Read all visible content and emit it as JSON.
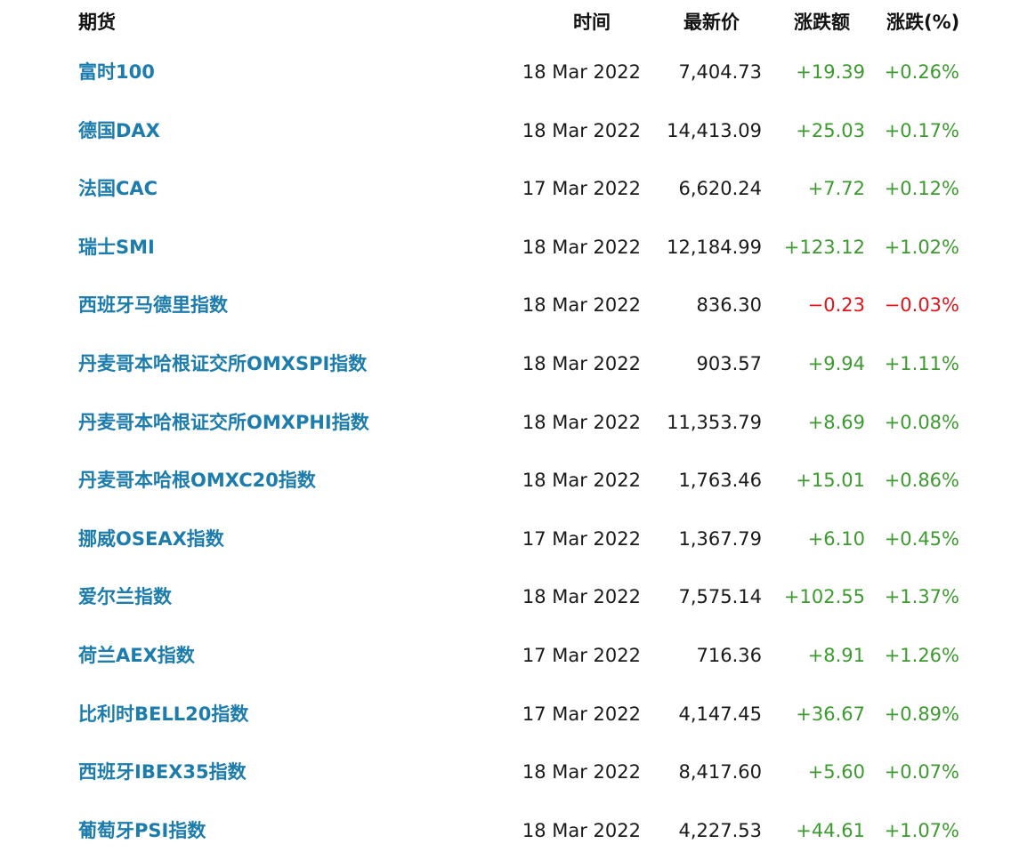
{
  "header": {
    "name": "期货",
    "time": "时间",
    "price": "最新价",
    "change": "涨跌额",
    "pct": "涨跌(%)"
  },
  "colors": {
    "link": "#1c7cad",
    "up": "#3c9a2f",
    "down": "#e3141b",
    "text": "#1a1a1a"
  },
  "rows": [
    {
      "name": "富时100",
      "date": "18 Mar 2022",
      "price": "7,404.73",
      "change": "+19.39",
      "pct": "+0.26%",
      "dir": "up"
    },
    {
      "name": "德国DAX",
      "date": "18 Mar 2022",
      "price": "14,413.09",
      "change": "+25.03",
      "pct": "+0.17%",
      "dir": "up"
    },
    {
      "name": "法国CAC",
      "date": "17 Mar 2022",
      "price": "6,620.24",
      "change": "+7.72",
      "pct": "+0.12%",
      "dir": "up"
    },
    {
      "name": "瑞士SMI",
      "date": "18 Mar 2022",
      "price": "12,184.99",
      "change": "+123.12",
      "pct": "+1.02%",
      "dir": "up"
    },
    {
      "name": "西班牙马德里指数",
      "date": "18 Mar 2022",
      "price": "836.30",
      "change": "−0.23",
      "pct": "−0.03%",
      "dir": "down"
    },
    {
      "name": "丹麦哥本哈根证交所OMXSPI指数",
      "date": "18 Mar 2022",
      "price": "903.57",
      "change": "+9.94",
      "pct": "+1.11%",
      "dir": "up"
    },
    {
      "name": "丹麦哥本哈根证交所OMXPHI指数",
      "date": "18 Mar 2022",
      "price": "11,353.79",
      "change": "+8.69",
      "pct": "+0.08%",
      "dir": "up"
    },
    {
      "name": "丹麦哥本哈根OMXC20指数",
      "date": "18 Mar 2022",
      "price": "1,763.46",
      "change": "+15.01",
      "pct": "+0.86%",
      "dir": "up"
    },
    {
      "name": "挪威OSEAX指数",
      "date": "17 Mar 2022",
      "price": "1,367.79",
      "change": "+6.10",
      "pct": "+0.45%",
      "dir": "up"
    },
    {
      "name": "爱尔兰指数",
      "date": "18 Mar 2022",
      "price": "7,575.14",
      "change": "+102.55",
      "pct": "+1.37%",
      "dir": "up"
    },
    {
      "name": "荷兰AEX指数",
      "date": "17 Mar 2022",
      "price": "716.36",
      "change": "+8.91",
      "pct": "+1.26%",
      "dir": "up"
    },
    {
      "name": "比利时BELL20指数",
      "date": "17 Mar 2022",
      "price": "4,147.45",
      "change": "+36.67",
      "pct": "+0.89%",
      "dir": "up"
    },
    {
      "name": "西班牙IBEX35指数",
      "date": "18 Mar 2022",
      "price": "8,417.60",
      "change": "+5.60",
      "pct": "+0.07%",
      "dir": "up"
    },
    {
      "name": "葡萄牙PSI指数",
      "date": "18 Mar 2022",
      "price": "4,227.53",
      "change": "+44.61",
      "pct": "+1.07%",
      "dir": "up"
    }
  ]
}
